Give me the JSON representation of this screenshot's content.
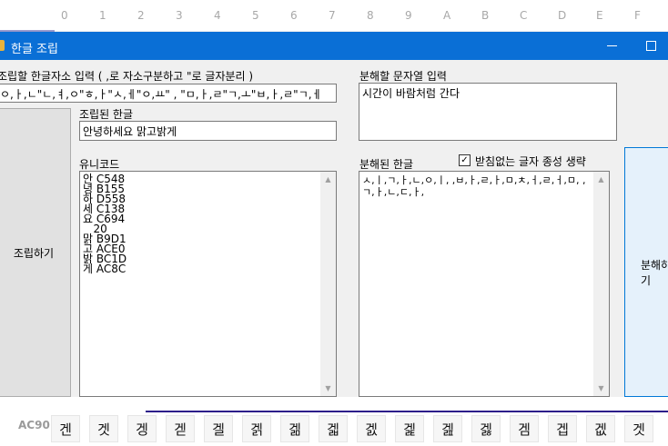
{
  "hex_header": {
    "columns": [
      "0",
      "1",
      "2",
      "3",
      "4",
      "5",
      "6",
      "7",
      "8",
      "9",
      "A",
      "B",
      "C",
      "D",
      "E",
      "F"
    ]
  },
  "footer": {
    "label": "AC90",
    "cells": [
      "겐",
      "겟",
      "겡",
      "겓",
      "겔",
      "겕",
      "겖",
      "겗",
      "겘",
      "겙",
      "겚",
      "겛",
      "겜",
      "겝",
      "겞",
      "겟"
    ]
  },
  "window": {
    "title": "한글 조립"
  },
  "assemble": {
    "input_label": "조립할 한글자소 입력 ( ,로 자소구분하고 \"로 글자분리 )",
    "input_value": "ㅇ,ㅏ,ㄴ\"ㄴ,ㅕ,ㅇ\"ㅎ,ㅏ\"ㅅ,ㅔ\"ㅇ,ㅛ\" , \"ㅁ,ㅏ,ㄹ\"ㄱ,ㅗ\"ㅂ,ㅏ,ㄹ\"ㄱ,ㅔ",
    "result_label": "조립된 한글",
    "result_value": "안녕하세요 맑고밝게",
    "unicode_label": "유니코드",
    "unicode_lines": [
      "안 C548",
      "녕 B155",
      "하 D558",
      "세 C138",
      "요 C694",
      "   20",
      "맑 B9D1",
      "고 ACE0",
      "밝 BC1D",
      "게 AC8C"
    ],
    "button": "조립하기"
  },
  "decompose": {
    "input_label": "분해할 문자열 입력",
    "input_value": "시간이 바람처럼 간다",
    "result_label": "분해된 한글",
    "checkbox_label": "받침없는 글자 종성 생략",
    "checkbox_checked": true,
    "result_value": "ㅅ,ㅣ,ㄱ,ㅏ,ㄴ,ㅇ,ㅣ, ,ㅂ,ㅏ,ㄹ,ㅏ,ㅁ,ㅊ,ㅓ,ㄹ,ㅓ,ㅁ, ,ㄱ,ㅏ,ㄴ,ㄷ,ㅏ,",
    "button": "분해하기"
  }
}
